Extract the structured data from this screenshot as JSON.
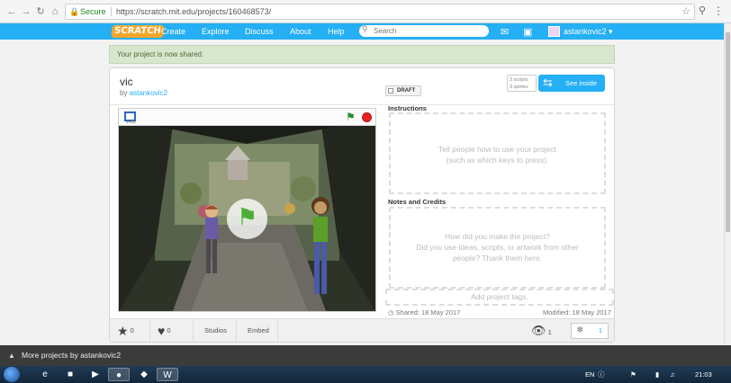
{
  "browser": {
    "secure_label": "Secure",
    "url": "https://scratch.mit.edu/projects/160468573/"
  },
  "scratch_nav": {
    "logo": "SCRATCH",
    "links": [
      "Create",
      "Explore",
      "Discuss",
      "About",
      "Help"
    ],
    "search_placeholder": "Search",
    "username": "astankovic2"
  },
  "banner": "Your project is now shared.",
  "project": {
    "title": "vic",
    "by_prefix": "by",
    "author": "astankovic2",
    "draft_label": "DRAFT",
    "stats_scripts": "3 scripts",
    "stats_sprites": "3 sprites",
    "see_inside_label": "See inside",
    "player_version": "v458"
  },
  "instructions": {
    "label": "Instructions",
    "placeholder_line1": "Tell people how to use your project",
    "placeholder_line2": "(such as which keys to press)."
  },
  "notes": {
    "label": "Notes and Credits",
    "placeholder_line1": "How did you make the project?",
    "placeholder_line2": "Did you use ideas, scripts, or artwork from other",
    "placeholder_line3": "people? Thank them here."
  },
  "tags_placeholder": "Add project tags.",
  "dates": {
    "shared": "Shared: 18 May 2017",
    "modified": "Modified: 18 May 2017"
  },
  "actions": {
    "loves": "0",
    "favorites": "0",
    "studios_label": "Studios",
    "embed_label": "Embed",
    "views": "1",
    "remixes": "1"
  },
  "more_projects": "More projects by astankovic2",
  "taskbar": {
    "language": "EN",
    "clock": "21:03"
  },
  "colors": {
    "scratch_blue": "#25aff4",
    "banner_green": "#d8e6cd",
    "stop_red": "#e52222",
    "flag_green": "#4cae3a"
  }
}
